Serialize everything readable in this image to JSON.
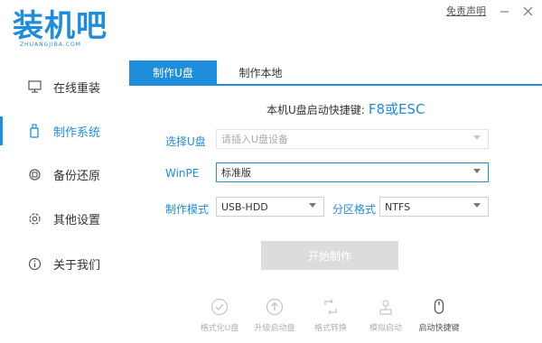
{
  "logo": {
    "text": "装机吧",
    "sub": "ZHUANGJIBA.COM"
  },
  "topbar": {
    "disclaimer": "免责声明",
    "minimize_icon": "minimize-icon",
    "close_icon": "close-icon"
  },
  "sidebar": {
    "items": [
      {
        "label": "在线重装",
        "icon": "monitor-icon"
      },
      {
        "label": "制作系统",
        "icon": "usb-icon",
        "active": true
      },
      {
        "label": "备份还原",
        "icon": "backup-icon"
      },
      {
        "label": "其他设置",
        "icon": "gear-icon"
      },
      {
        "label": "关于我们",
        "icon": "info-icon"
      }
    ]
  },
  "tabs": [
    {
      "label": "制作U盘",
      "active": true
    },
    {
      "label": "制作本地",
      "active": false
    }
  ],
  "hotkey": {
    "label": "本机U盘启动快捷键:",
    "keys": "F8或ESC"
  },
  "form": {
    "usb_label": "选择U盘",
    "usb_placeholder": "请插入U盘设备",
    "winpe_label": "WinPE",
    "winpe_value": "标准版",
    "mode_label": "制作模式",
    "mode_value": "USB-HDD",
    "partition_label": "分区格式",
    "partition_value": "NTFS"
  },
  "start_button": "开始制作",
  "toolbar": [
    {
      "label": "格式化U盘",
      "icon": "check-circle-icon"
    },
    {
      "label": "升级启动盘",
      "icon": "upload-circle-icon"
    },
    {
      "label": "格式转换",
      "icon": "convert-icon"
    },
    {
      "label": "模拟启动",
      "icon": "simulate-icon"
    },
    {
      "label": "启动快捷键",
      "icon": "mouse-icon",
      "active": true
    }
  ],
  "colors": {
    "accent": "#1e8ddc",
    "disabled": "#dcdcdc"
  }
}
